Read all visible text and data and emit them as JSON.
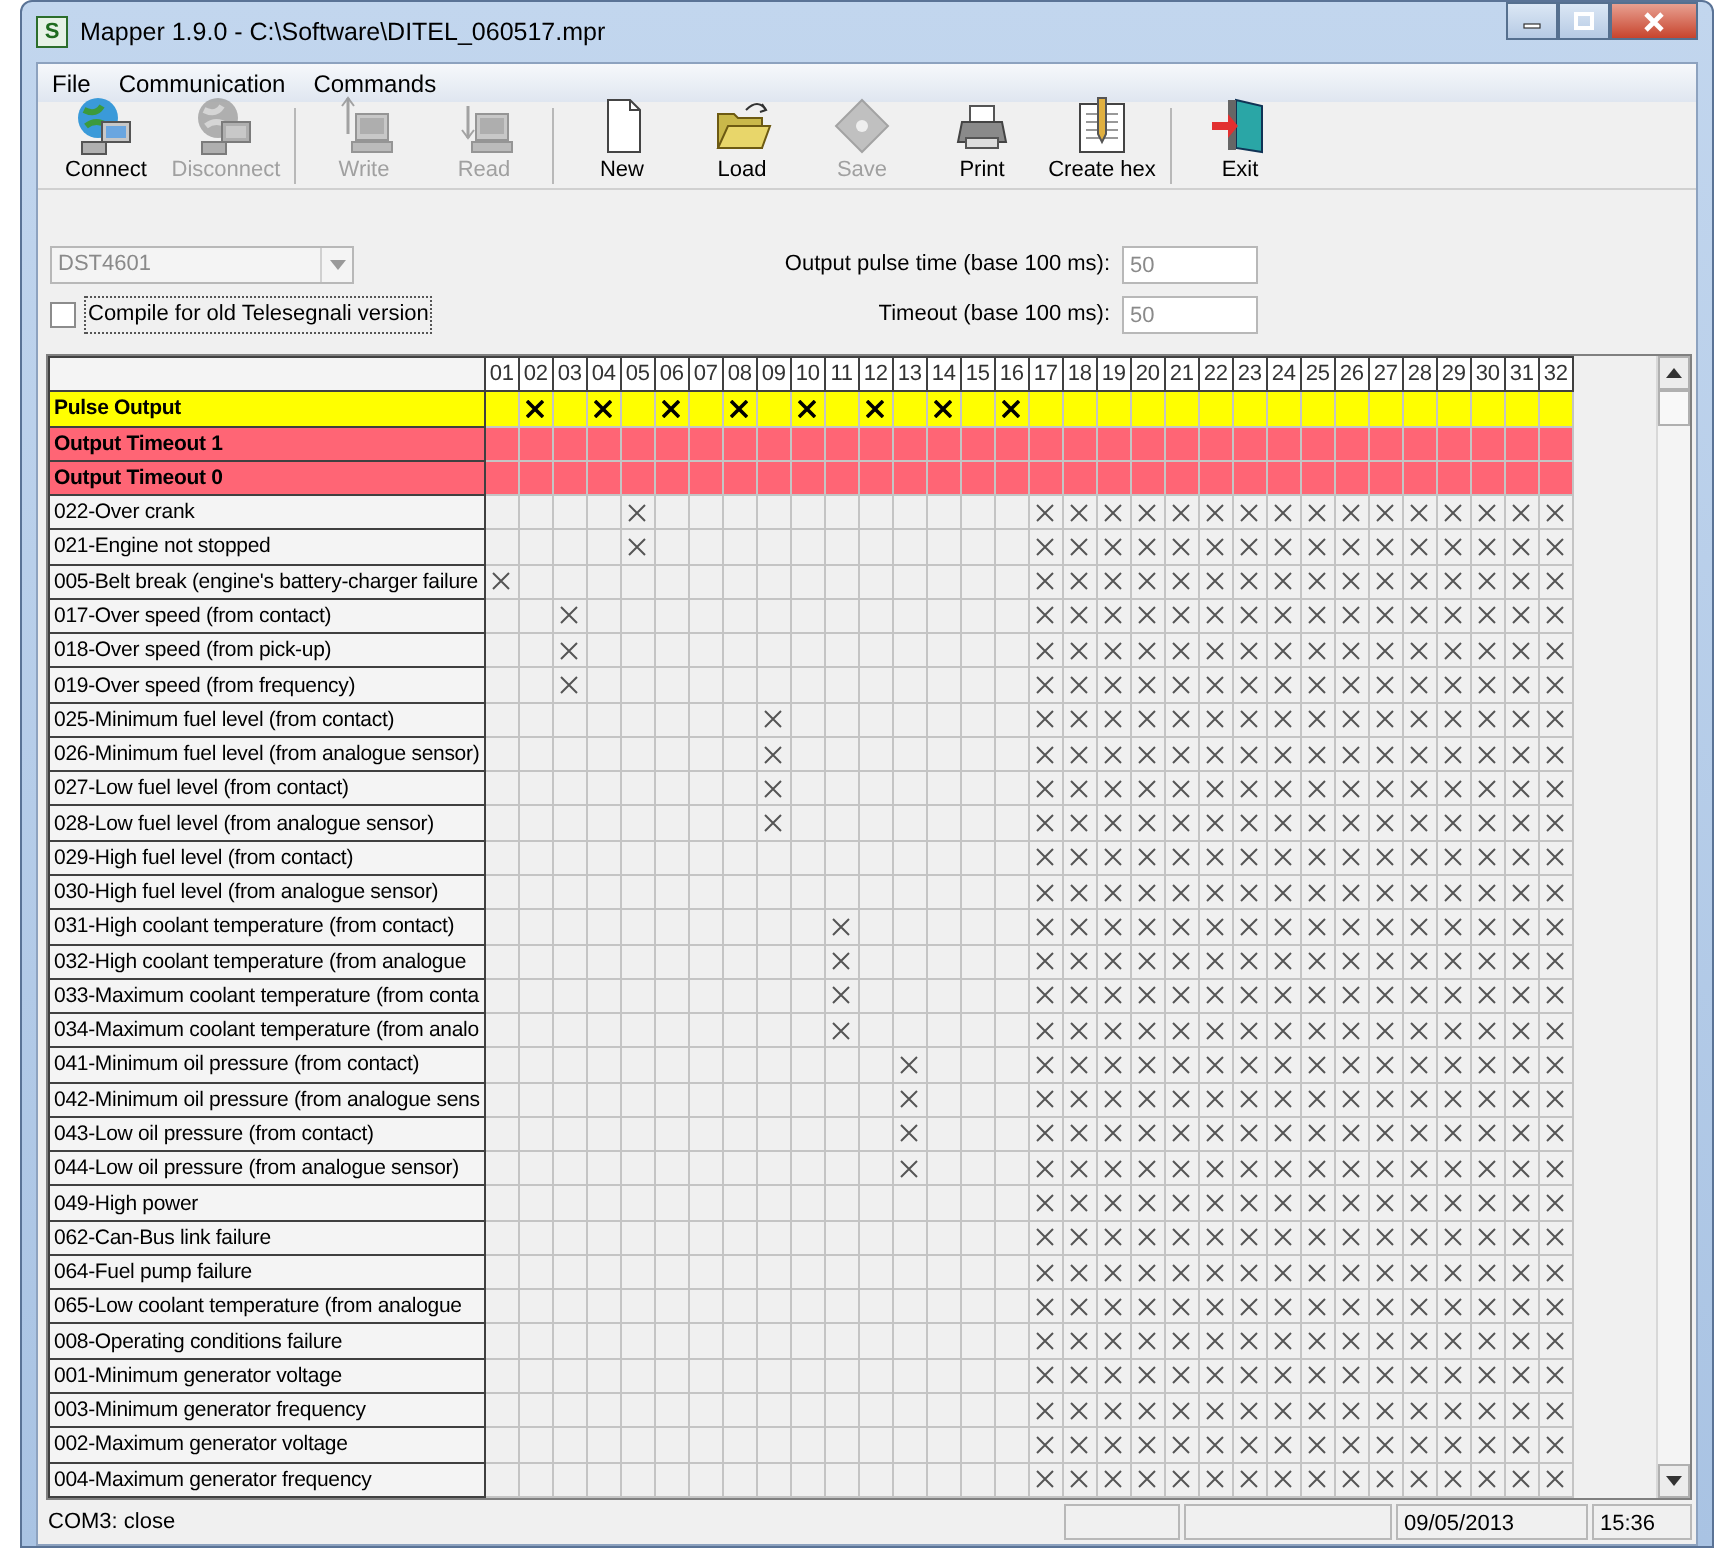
{
  "window": {
    "title": "Mapper 1.9.0 - C:\\Software\\DITEL_060517.mpr",
    "app_icon": "S"
  },
  "menu": [
    "File",
    "Communication",
    "Commands"
  ],
  "toolbar": [
    {
      "kind": "connect",
      "label": "Connect",
      "disabled": false,
      "separator_before": false
    },
    {
      "kind": "disconnect",
      "label": "Disconnect",
      "disabled": true,
      "separator_before": false
    },
    {
      "kind": "write",
      "label": "Write",
      "disabled": true,
      "separator_before": true
    },
    {
      "kind": "read",
      "label": "Read",
      "disabled": true,
      "separator_before": false
    },
    {
      "kind": "new",
      "label": "New",
      "disabled": false,
      "separator_before": true
    },
    {
      "kind": "load",
      "label": "Load",
      "disabled": false,
      "separator_before": false
    },
    {
      "kind": "save",
      "label": "Save",
      "disabled": true,
      "separator_before": false
    },
    {
      "kind": "print",
      "label": "Print",
      "disabled": false,
      "separator_before": false
    },
    {
      "kind": "hex",
      "label": "Create hex",
      "disabled": false,
      "separator_before": false
    },
    {
      "kind": "exit",
      "label": "Exit",
      "disabled": false,
      "separator_before": true
    }
  ],
  "device_select": {
    "value": "DST4601",
    "disabled": true
  },
  "compile_old": {
    "label": "Compile for old Telesegnali version",
    "checked": false
  },
  "fields": [
    {
      "label": "Output pulse time (base 100 ms):",
      "value": "50"
    },
    {
      "label": "Timeout (base 100 ms):",
      "value": "50"
    }
  ],
  "grid": {
    "columns": [
      "01",
      "02",
      "03",
      "04",
      "05",
      "06",
      "07",
      "08",
      "09",
      "10",
      "11",
      "12",
      "13",
      "14",
      "15",
      "16",
      "17",
      "18",
      "19",
      "20",
      "21",
      "22",
      "23",
      "24",
      "25",
      "26",
      "27",
      "28",
      "29",
      "30",
      "31",
      "32"
    ],
    "rows": [
      {
        "kind": "pulse",
        "name": "Pulse Output",
        "checked": [
          false,
          true,
          false,
          true,
          false,
          true,
          false,
          true,
          false,
          true,
          false,
          true,
          false,
          true,
          false,
          true,
          false,
          false,
          false,
          false,
          false,
          false,
          false,
          false,
          false,
          false,
          false,
          false,
          false,
          false,
          false,
          false
        ]
      },
      {
        "kind": "timeout",
        "name": "Output Timeout 1",
        "checked": [
          false,
          false,
          false,
          false,
          false,
          false,
          false,
          false,
          false,
          false,
          false,
          false,
          false,
          false,
          false,
          false,
          false,
          false,
          false,
          false,
          false,
          false,
          false,
          false,
          false,
          false,
          false,
          false,
          false,
          false,
          false,
          false
        ]
      },
      {
        "kind": "timeout",
        "name": "Output Timeout 0",
        "checked": [
          false,
          false,
          false,
          false,
          false,
          false,
          false,
          false,
          false,
          false,
          false,
          false,
          false,
          false,
          false,
          false,
          false,
          false,
          false,
          false,
          false,
          false,
          false,
          false,
          false,
          false,
          false,
          false,
          false,
          false,
          false,
          false
        ]
      },
      {
        "kind": "alarm",
        "name": "022-Over crank",
        "checked": [
          false,
          false,
          false,
          false,
          true,
          false,
          false,
          false,
          false,
          false,
          false,
          false,
          false,
          false,
          false,
          false,
          true,
          true,
          true,
          true,
          true,
          true,
          true,
          true,
          true,
          true,
          true,
          true,
          true,
          true,
          true,
          true
        ]
      },
      {
        "kind": "alarm",
        "name": "021-Engine not stopped",
        "checked": [
          false,
          false,
          false,
          false,
          true,
          false,
          false,
          false,
          false,
          false,
          false,
          false,
          false,
          false,
          false,
          false,
          true,
          true,
          true,
          true,
          true,
          true,
          true,
          true,
          true,
          true,
          true,
          true,
          true,
          true,
          true,
          true
        ]
      },
      {
        "kind": "alarm",
        "name": "005-Belt break (engine's battery-charger failure",
        "checked": [
          true,
          false,
          false,
          false,
          false,
          false,
          false,
          false,
          false,
          false,
          false,
          false,
          false,
          false,
          false,
          false,
          true,
          true,
          true,
          true,
          true,
          true,
          true,
          true,
          true,
          true,
          true,
          true,
          true,
          true,
          true,
          true
        ]
      },
      {
        "kind": "alarm",
        "name": "017-Over speed (from contact)",
        "checked": [
          false,
          false,
          true,
          false,
          false,
          false,
          false,
          false,
          false,
          false,
          false,
          false,
          false,
          false,
          false,
          false,
          true,
          true,
          true,
          true,
          true,
          true,
          true,
          true,
          true,
          true,
          true,
          true,
          true,
          true,
          true,
          true
        ]
      },
      {
        "kind": "alarm",
        "name": "018-Over speed (from pick-up)",
        "checked": [
          false,
          false,
          true,
          false,
          false,
          false,
          false,
          false,
          false,
          false,
          false,
          false,
          false,
          false,
          false,
          false,
          true,
          true,
          true,
          true,
          true,
          true,
          true,
          true,
          true,
          true,
          true,
          true,
          true,
          true,
          true,
          true
        ]
      },
      {
        "kind": "alarm",
        "name": "019-Over speed (from frequency)",
        "checked": [
          false,
          false,
          true,
          false,
          false,
          false,
          false,
          false,
          false,
          false,
          false,
          false,
          false,
          false,
          false,
          false,
          true,
          true,
          true,
          true,
          true,
          true,
          true,
          true,
          true,
          true,
          true,
          true,
          true,
          true,
          true,
          true
        ]
      },
      {
        "kind": "alarm",
        "name": "025-Minimum fuel level (from contact)",
        "checked": [
          false,
          false,
          false,
          false,
          false,
          false,
          false,
          false,
          true,
          false,
          false,
          false,
          false,
          false,
          false,
          false,
          true,
          true,
          true,
          true,
          true,
          true,
          true,
          true,
          true,
          true,
          true,
          true,
          true,
          true,
          true,
          true
        ]
      },
      {
        "kind": "alarm",
        "name": "026-Minimum fuel level (from analogue sensor)",
        "checked": [
          false,
          false,
          false,
          false,
          false,
          false,
          false,
          false,
          true,
          false,
          false,
          false,
          false,
          false,
          false,
          false,
          true,
          true,
          true,
          true,
          true,
          true,
          true,
          true,
          true,
          true,
          true,
          true,
          true,
          true,
          true,
          true
        ]
      },
      {
        "kind": "alarm",
        "name": "027-Low fuel level (from contact)",
        "checked": [
          false,
          false,
          false,
          false,
          false,
          false,
          false,
          false,
          true,
          false,
          false,
          false,
          false,
          false,
          false,
          false,
          true,
          true,
          true,
          true,
          true,
          true,
          true,
          true,
          true,
          true,
          true,
          true,
          true,
          true,
          true,
          true
        ]
      },
      {
        "kind": "alarm",
        "name": "028-Low fuel level (from analogue sensor)",
        "checked": [
          false,
          false,
          false,
          false,
          false,
          false,
          false,
          false,
          true,
          false,
          false,
          false,
          false,
          false,
          false,
          false,
          true,
          true,
          true,
          true,
          true,
          true,
          true,
          true,
          true,
          true,
          true,
          true,
          true,
          true,
          true,
          true
        ]
      },
      {
        "kind": "alarm",
        "name": "029-High fuel level (from contact)",
        "checked": [
          false,
          false,
          false,
          false,
          false,
          false,
          false,
          false,
          false,
          false,
          false,
          false,
          false,
          false,
          false,
          false,
          true,
          true,
          true,
          true,
          true,
          true,
          true,
          true,
          true,
          true,
          true,
          true,
          true,
          true,
          true,
          true
        ]
      },
      {
        "kind": "alarm",
        "name": "030-High fuel level (from analogue sensor)",
        "checked": [
          false,
          false,
          false,
          false,
          false,
          false,
          false,
          false,
          false,
          false,
          false,
          false,
          false,
          false,
          false,
          false,
          true,
          true,
          true,
          true,
          true,
          true,
          true,
          true,
          true,
          true,
          true,
          true,
          true,
          true,
          true,
          true
        ]
      },
      {
        "kind": "alarm",
        "name": "031-High coolant temperature (from contact)",
        "checked": [
          false,
          false,
          false,
          false,
          false,
          false,
          false,
          false,
          false,
          false,
          true,
          false,
          false,
          false,
          false,
          false,
          true,
          true,
          true,
          true,
          true,
          true,
          true,
          true,
          true,
          true,
          true,
          true,
          true,
          true,
          true,
          true
        ]
      },
      {
        "kind": "alarm",
        "name": "032-High coolant temperature (from analogue",
        "checked": [
          false,
          false,
          false,
          false,
          false,
          false,
          false,
          false,
          false,
          false,
          true,
          false,
          false,
          false,
          false,
          false,
          true,
          true,
          true,
          true,
          true,
          true,
          true,
          true,
          true,
          true,
          true,
          true,
          true,
          true,
          true,
          true
        ]
      },
      {
        "kind": "alarm",
        "name": "033-Maximum coolant temperature (from conta",
        "checked": [
          false,
          false,
          false,
          false,
          false,
          false,
          false,
          false,
          false,
          false,
          true,
          false,
          false,
          false,
          false,
          false,
          true,
          true,
          true,
          true,
          true,
          true,
          true,
          true,
          true,
          true,
          true,
          true,
          true,
          true,
          true,
          true
        ]
      },
      {
        "kind": "alarm",
        "name": "034-Maximum coolant temperature (from analo",
        "checked": [
          false,
          false,
          false,
          false,
          false,
          false,
          false,
          false,
          false,
          false,
          true,
          false,
          false,
          false,
          false,
          false,
          true,
          true,
          true,
          true,
          true,
          true,
          true,
          true,
          true,
          true,
          true,
          true,
          true,
          true,
          true,
          true
        ]
      },
      {
        "kind": "alarm",
        "name": "041-Minimum oil pressure (from contact)",
        "checked": [
          false,
          false,
          false,
          false,
          false,
          false,
          false,
          false,
          false,
          false,
          false,
          false,
          true,
          false,
          false,
          false,
          true,
          true,
          true,
          true,
          true,
          true,
          true,
          true,
          true,
          true,
          true,
          true,
          true,
          true,
          true,
          true
        ]
      },
      {
        "kind": "alarm",
        "name": "042-Minimum oil pressure (from analogue sens",
        "checked": [
          false,
          false,
          false,
          false,
          false,
          false,
          false,
          false,
          false,
          false,
          false,
          false,
          true,
          false,
          false,
          false,
          true,
          true,
          true,
          true,
          true,
          true,
          true,
          true,
          true,
          true,
          true,
          true,
          true,
          true,
          true,
          true
        ]
      },
      {
        "kind": "alarm",
        "name": "043-Low oil pressure (from contact)",
        "checked": [
          false,
          false,
          false,
          false,
          false,
          false,
          false,
          false,
          false,
          false,
          false,
          false,
          true,
          false,
          false,
          false,
          true,
          true,
          true,
          true,
          true,
          true,
          true,
          true,
          true,
          true,
          true,
          true,
          true,
          true,
          true,
          true
        ]
      },
      {
        "kind": "alarm",
        "name": "044-Low oil pressure (from analogue sensor)",
        "checked": [
          false,
          false,
          false,
          false,
          false,
          false,
          false,
          false,
          false,
          false,
          false,
          false,
          true,
          false,
          false,
          false,
          true,
          true,
          true,
          true,
          true,
          true,
          true,
          true,
          true,
          true,
          true,
          true,
          true,
          true,
          true,
          true
        ]
      },
      {
        "kind": "alarm",
        "name": "049-High power",
        "checked": [
          false,
          false,
          false,
          false,
          false,
          false,
          false,
          false,
          false,
          false,
          false,
          false,
          false,
          false,
          false,
          false,
          true,
          true,
          true,
          true,
          true,
          true,
          true,
          true,
          true,
          true,
          true,
          true,
          true,
          true,
          true,
          true
        ]
      },
      {
        "kind": "alarm",
        "name": "062-Can-Bus link failure",
        "checked": [
          false,
          false,
          false,
          false,
          false,
          false,
          false,
          false,
          false,
          false,
          false,
          false,
          false,
          false,
          false,
          false,
          true,
          true,
          true,
          true,
          true,
          true,
          true,
          true,
          true,
          true,
          true,
          true,
          true,
          true,
          true,
          true
        ]
      },
      {
        "kind": "alarm",
        "name": "064-Fuel pump failure",
        "checked": [
          false,
          false,
          false,
          false,
          false,
          false,
          false,
          false,
          false,
          false,
          false,
          false,
          false,
          false,
          false,
          false,
          true,
          true,
          true,
          true,
          true,
          true,
          true,
          true,
          true,
          true,
          true,
          true,
          true,
          true,
          true,
          true
        ]
      },
      {
        "kind": "alarm",
        "name": "065-Low coolant temperature (from analogue",
        "checked": [
          false,
          false,
          false,
          false,
          false,
          false,
          false,
          false,
          false,
          false,
          false,
          false,
          false,
          false,
          false,
          false,
          true,
          true,
          true,
          true,
          true,
          true,
          true,
          true,
          true,
          true,
          true,
          true,
          true,
          true,
          true,
          true
        ]
      },
      {
        "kind": "alarm",
        "name": "008-Operating conditions failure",
        "checked": [
          false,
          false,
          false,
          false,
          false,
          false,
          false,
          false,
          false,
          false,
          false,
          false,
          false,
          false,
          false,
          false,
          true,
          true,
          true,
          true,
          true,
          true,
          true,
          true,
          true,
          true,
          true,
          true,
          true,
          true,
          true,
          true
        ]
      },
      {
        "kind": "alarm",
        "name": "001-Minimum generator voltage",
        "checked": [
          false,
          false,
          false,
          false,
          false,
          false,
          false,
          false,
          false,
          false,
          false,
          false,
          false,
          false,
          false,
          false,
          true,
          true,
          true,
          true,
          true,
          true,
          true,
          true,
          true,
          true,
          true,
          true,
          true,
          true,
          true,
          true
        ]
      },
      {
        "kind": "alarm",
        "name": "003-Minimum generator frequency",
        "checked": [
          false,
          false,
          false,
          false,
          false,
          false,
          false,
          false,
          false,
          false,
          false,
          false,
          false,
          false,
          false,
          false,
          true,
          true,
          true,
          true,
          true,
          true,
          true,
          true,
          true,
          true,
          true,
          true,
          true,
          true,
          true,
          true
        ]
      },
      {
        "kind": "alarm",
        "name": "002-Maximum generator voltage",
        "checked": [
          false,
          false,
          false,
          false,
          false,
          false,
          false,
          false,
          false,
          false,
          false,
          false,
          false,
          false,
          false,
          false,
          true,
          true,
          true,
          true,
          true,
          true,
          true,
          true,
          true,
          true,
          true,
          true,
          true,
          true,
          true,
          true
        ]
      },
      {
        "kind": "alarm",
        "name": "004-Maximum generator frequency",
        "checked": [
          false,
          false,
          false,
          false,
          false,
          false,
          false,
          false,
          false,
          false,
          false,
          false,
          false,
          false,
          false,
          false,
          true,
          true,
          true,
          true,
          true,
          true,
          true,
          true,
          true,
          true,
          true,
          true,
          true,
          true,
          true,
          true
        ]
      }
    ]
  },
  "status_bar": {
    "port": "COM3: close",
    "date": "09/05/2013",
    "time": "15:36"
  }
}
